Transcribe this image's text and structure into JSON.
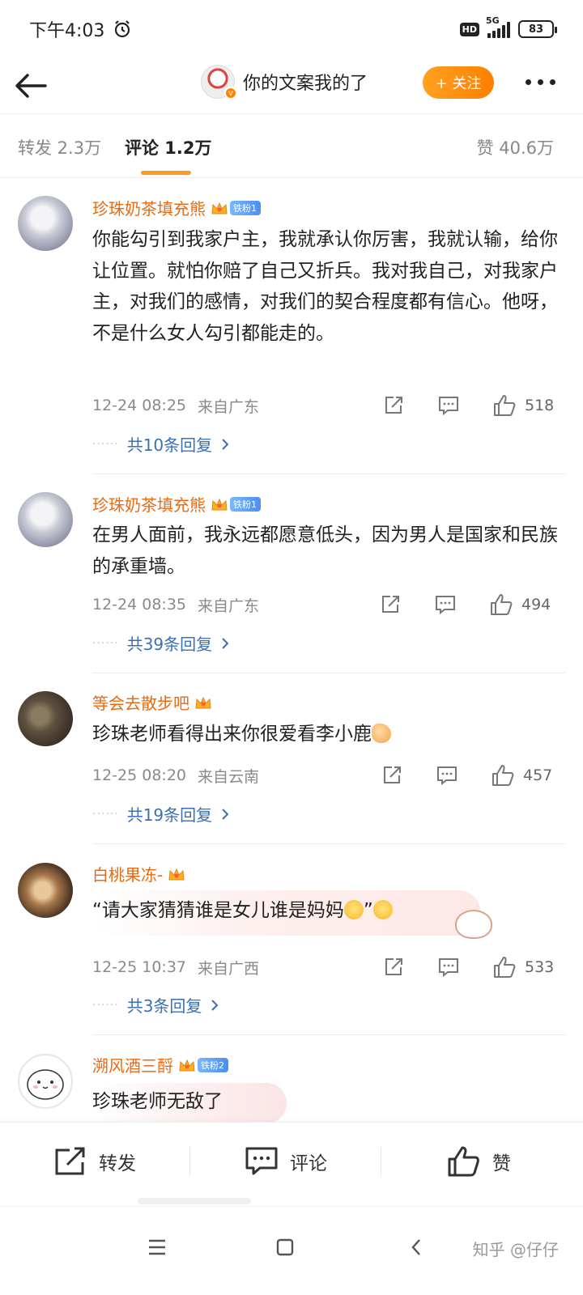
{
  "status_bar": {
    "time": "下午4:03",
    "hd": "HD",
    "network": "5G",
    "battery": "83"
  },
  "header": {
    "title": "你的文案我的了",
    "follow_label": "+ 关注"
  },
  "tabs": [
    {
      "label": "转发 2.3万"
    },
    {
      "label": "评论 1.2万"
    },
    {
      "label": "赞 40.6万"
    }
  ],
  "comments": [
    {
      "user": "珍珠奶茶填充熊",
      "fan_badge": "铁粉1",
      "text": "你能勾引到我家户主，我就承认你厉害，我就认输，给你让位置。就怕你赔了自己又折兵。我对我自己，对我家户主，对我们的感情，对我们的契合程度都有信心。他呀，不是什么女人勾引都能走的。",
      "time": "12-24 08:25",
      "location": "来自广东",
      "likes": "518",
      "replies": "共10条回复"
    },
    {
      "user": "珍珠奶茶填充熊",
      "fan_badge": "铁粉1",
      "text": "在男人面前，我永远都愿意低头，因为男人是国家和民族的承重墙。",
      "time": "12-24 08:35",
      "location": "来自广东",
      "likes": "494",
      "replies": "共39条回复"
    },
    {
      "user": "等会去散步吧",
      "text": "珍珠老师看得出来你很爱看李小鹿",
      "time": "12-25 08:20",
      "location": "来自云南",
      "likes": "457",
      "replies": "共19条回复"
    },
    {
      "user": "白桃果冻-",
      "text": "“请大家猜猜谁是女儿谁是妈妈",
      "text_end": "”",
      "time": "12-25 10:37",
      "location": "来自广西",
      "likes": "533",
      "replies": "共3条回复"
    },
    {
      "user": "溯风酒三酹",
      "fan_badge": "铁粉2",
      "text": "珍珠老师无敌了"
    }
  ],
  "action_bar": {
    "repost": "转发",
    "comment": "评论",
    "like": "赞"
  },
  "watermark": "知乎 @仔仔",
  "colors": {
    "accent_orange": "#ff8a00",
    "username_orange": "#e86a12",
    "reply_blue": "#3b6fb6",
    "meta_gray": "#8a8a8a"
  }
}
